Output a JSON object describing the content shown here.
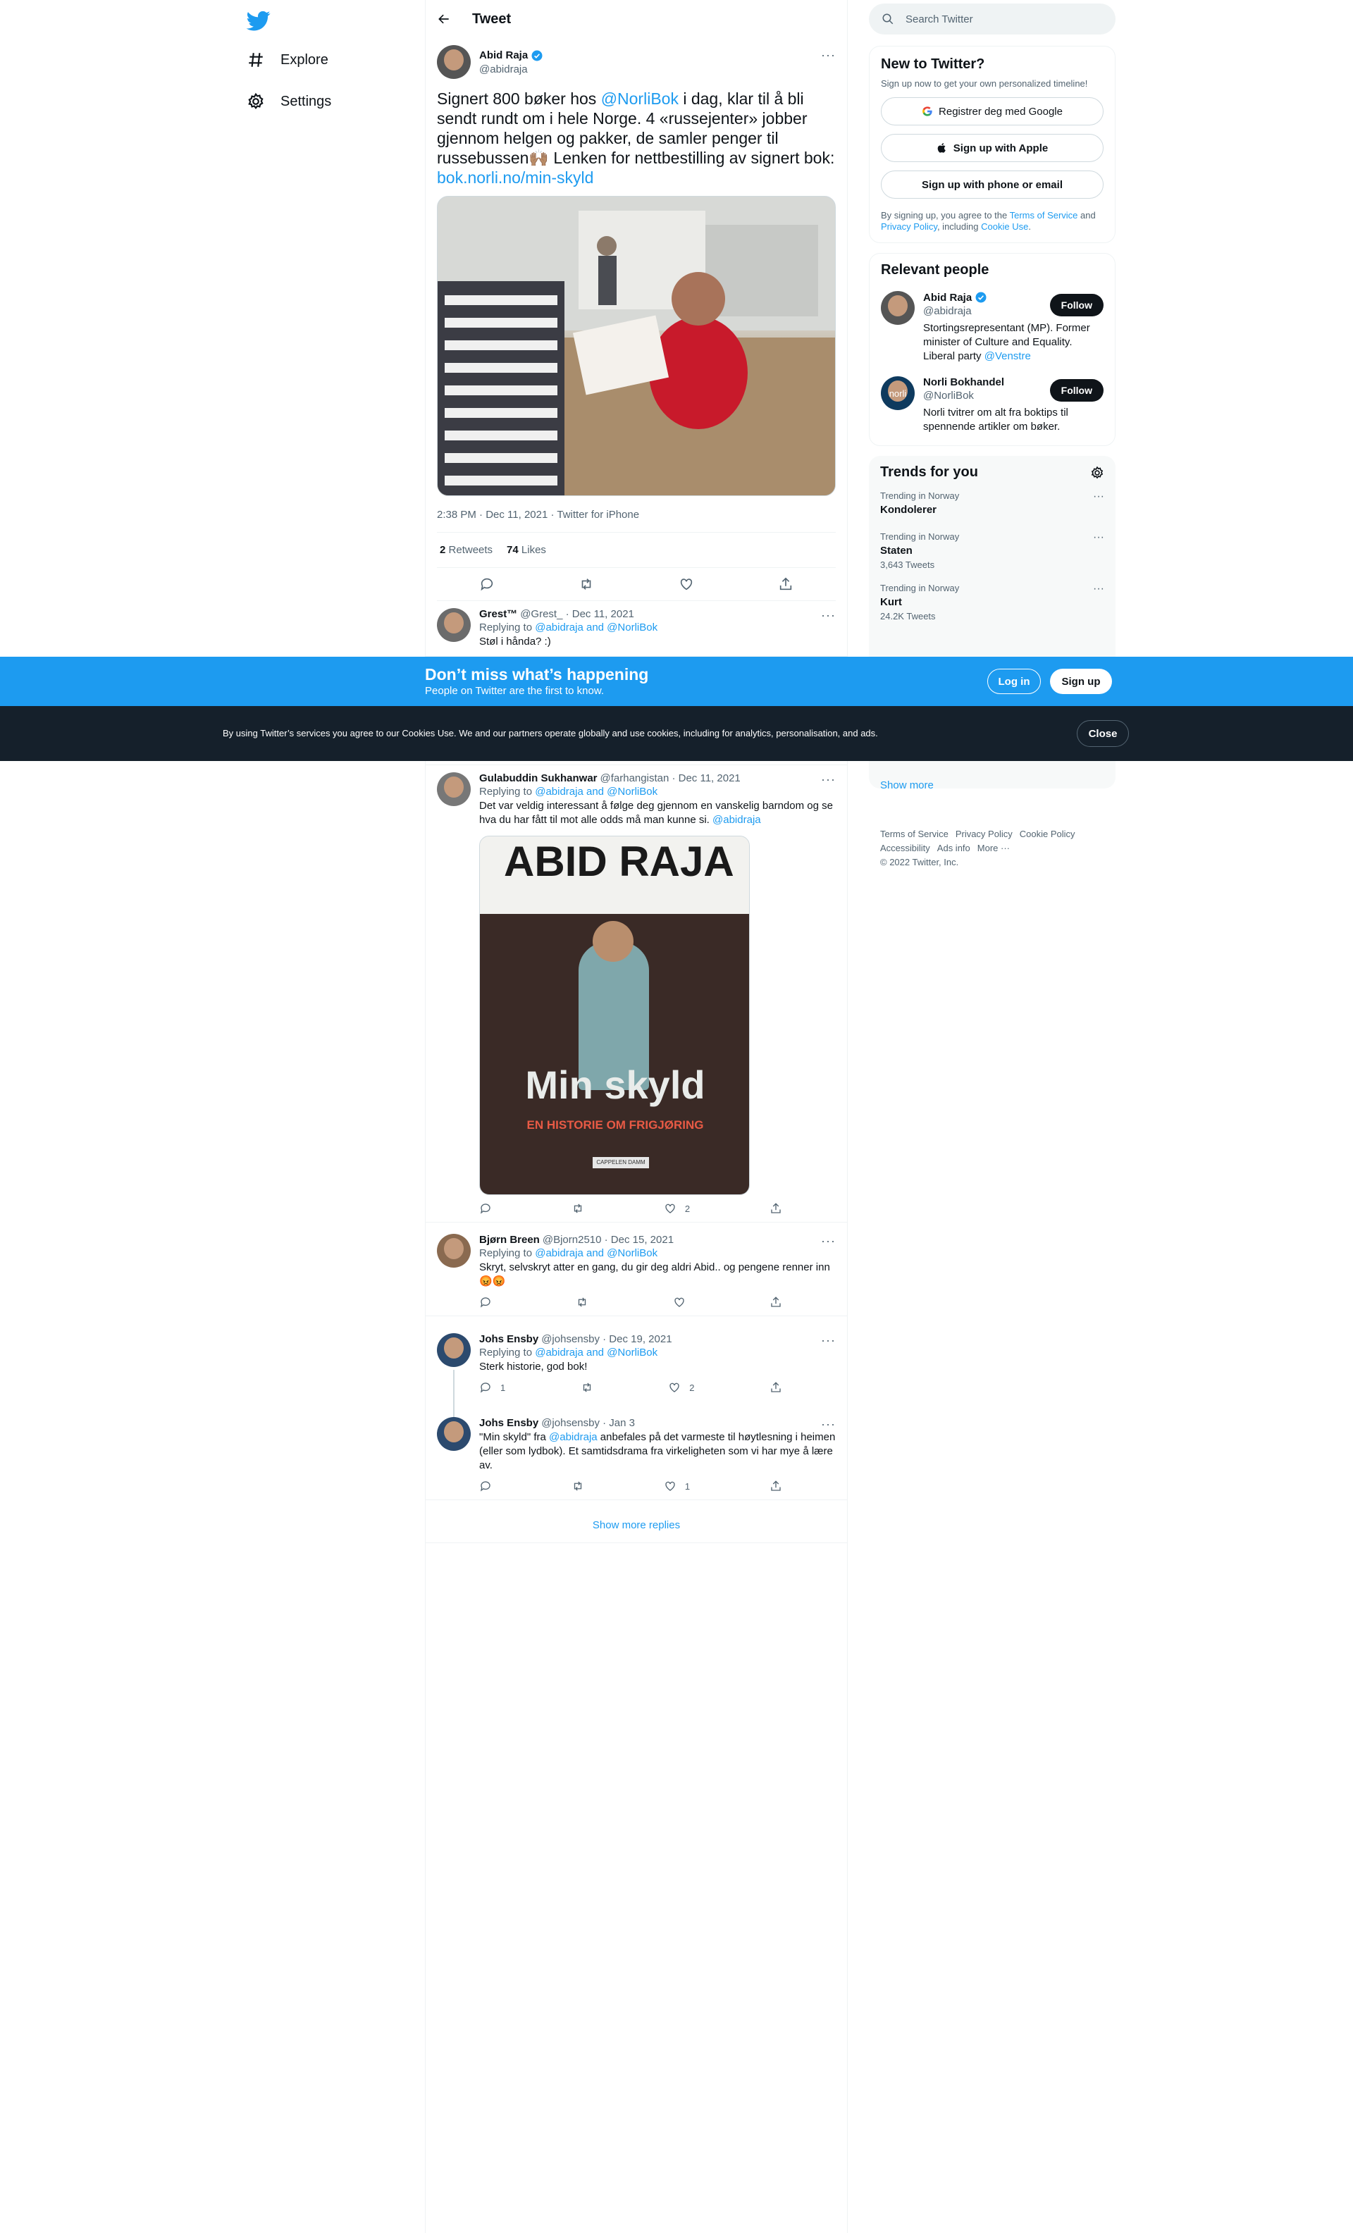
{
  "nav": {
    "items": [
      {
        "label": "Explore",
        "icon": "hashtag-icon"
      },
      {
        "label": "Settings",
        "icon": "gear-icon"
      }
    ]
  },
  "header": {
    "title": "Tweet"
  },
  "tweet": {
    "author_name": "Abid Raja",
    "author_handle": "@abidraja",
    "text_1": "Signert 800 bøker hos ",
    "mention": "@NorliBok",
    "text_2": " i dag, klar til å bli sendt rundt om i hele Norge. 4 «russejenter» jobber gjennom helgen og pakker, de samler penger til russebussen🙌🏽 Lenken for nettbestilling av signert bok: ",
    "link": "bok.norli.no/min-skyld",
    "meta": "2:38 PM · Dec 11, 2021 · Twitter for iPhone",
    "retweets_count": "2",
    "retweets_label": "Retweets",
    "likes_count": "74",
    "likes_label": "Likes"
  },
  "replies": [
    {
      "name": "Grest™",
      "handle_date": "@Grest_ · Dec 11, 2021",
      "replying_prefix": "Replying to ",
      "replying_to": "@abidraja and @NorliBok",
      "text": "Støl i hånda? :)"
    },
    {
      "name": "Gulabuddin Sukhanwar",
      "handle_date": "@farhangistan · Dec 11, 2021",
      "replying_prefix": "Replying to ",
      "replying_to": "@abidraja and @NorliBok",
      "text": "Det var veldig interessant å følge deg gjennom en vanskelig barndom og se hva du har fått til mot alle odds må man kunne si. ",
      "mention": "@abidraja",
      "book_title_top": "ABID RAJA",
      "book_title": "Min skyld",
      "book_subtitle": "EN HISTORIE OM FRIGJØRING",
      "book_publisher": "CAPPELEN DAMM",
      "likes": "2"
    },
    {
      "name": "Bjørn Breen",
      "handle_date": "@Bjorn2510 · Dec 15, 2021",
      "replying_prefix": "Replying to ",
      "replying_to": "@abidraja and @NorliBok",
      "text": "Skryt, selvskryt atter en gang, du gir deg aldri  Abid.. og pengene renner inn 😡😡"
    },
    {
      "name": "Johs Ensby",
      "handle_date": "@johsensby · Dec 19, 2021",
      "replying_prefix": "Replying to ",
      "replying_to": "@abidraja and @NorliBok",
      "text": "Sterk historie, god bok!",
      "replies": "1",
      "likes": "2"
    },
    {
      "name": "Johs Ensby",
      "handle_date": "@johsensby · Jan 3",
      "text_1": "\"Min skyld\" fra  ",
      "mention": "@abidraja",
      "text_2": " anbefales på det varmeste til høytlesning i heimen (eller som lydbok). Et samtidsdrama fra virkeligheten som vi har mye å lære av.",
      "likes": "1"
    }
  ],
  "show_more_replies": "Show more replies",
  "search": {
    "placeholder": "Search Twitter"
  },
  "signup_card": {
    "title": "New to Twitter?",
    "sub": "Sign up now to get your own personalized timeline!",
    "google": "Registrer deg med Google",
    "apple": "Sign up with Apple",
    "phone": "Sign up with phone or email",
    "legal_1": "By signing up, you agree to the ",
    "terms": "Terms of Service",
    "legal_2": " and ",
    "privacy": "Privacy Policy",
    "legal_3": ", including ",
    "cookie": "Cookie Use",
    "legal_4": "."
  },
  "relevant": {
    "title": "Relevant people",
    "people": [
      {
        "name": "Abid Raja",
        "handle": "@abidraja",
        "bio": "Stortingsrepresentant (MP). Former minister of Culture and Equality. Liberal party ",
        "bio_mention": "@Venstre",
        "follow": "Follow"
      },
      {
        "name": "Norli Bokhandel",
        "handle": "@NorliBok",
        "bio": "Norli tvitrer om alt fra boktips til spennende artikler om bøker.",
        "logo_text": "norli",
        "follow": "Follow"
      }
    ]
  },
  "trends": {
    "title": "Trends for you",
    "items": [
      {
        "context": "Trending in Norway",
        "name": "Kondolerer",
        "count": ""
      },
      {
        "context": "Trending in Norway",
        "name": "Staten",
        "count": "3,643 Tweets"
      },
      {
        "context": "Trending in Norway",
        "name": "Kurt",
        "count": "24.2K Tweets"
      }
    ],
    "show_more": "Show more"
  },
  "footer": {
    "links": [
      "Terms of Service",
      "Privacy Policy",
      "Cookie Policy",
      "Accessibility",
      "Ads info",
      "More ···"
    ],
    "copyright": "© 2022 Twitter, Inc."
  },
  "banner": {
    "title": "Don’t miss what’s happening",
    "sub": "People on Twitter are the first to know.",
    "login": "Log in",
    "signup": "Sign up"
  },
  "cookie_bar": {
    "text": "By using Twitter’s services you agree to our Cookies Use. We and our partners operate globally and use cookies, including for analytics, personalisation, and ads.",
    "close": "Close"
  },
  "colors": {
    "accent": "#1d9bf0",
    "text": "#0f1419",
    "muted": "#536471",
    "cookie_bg": "#15202b"
  }
}
